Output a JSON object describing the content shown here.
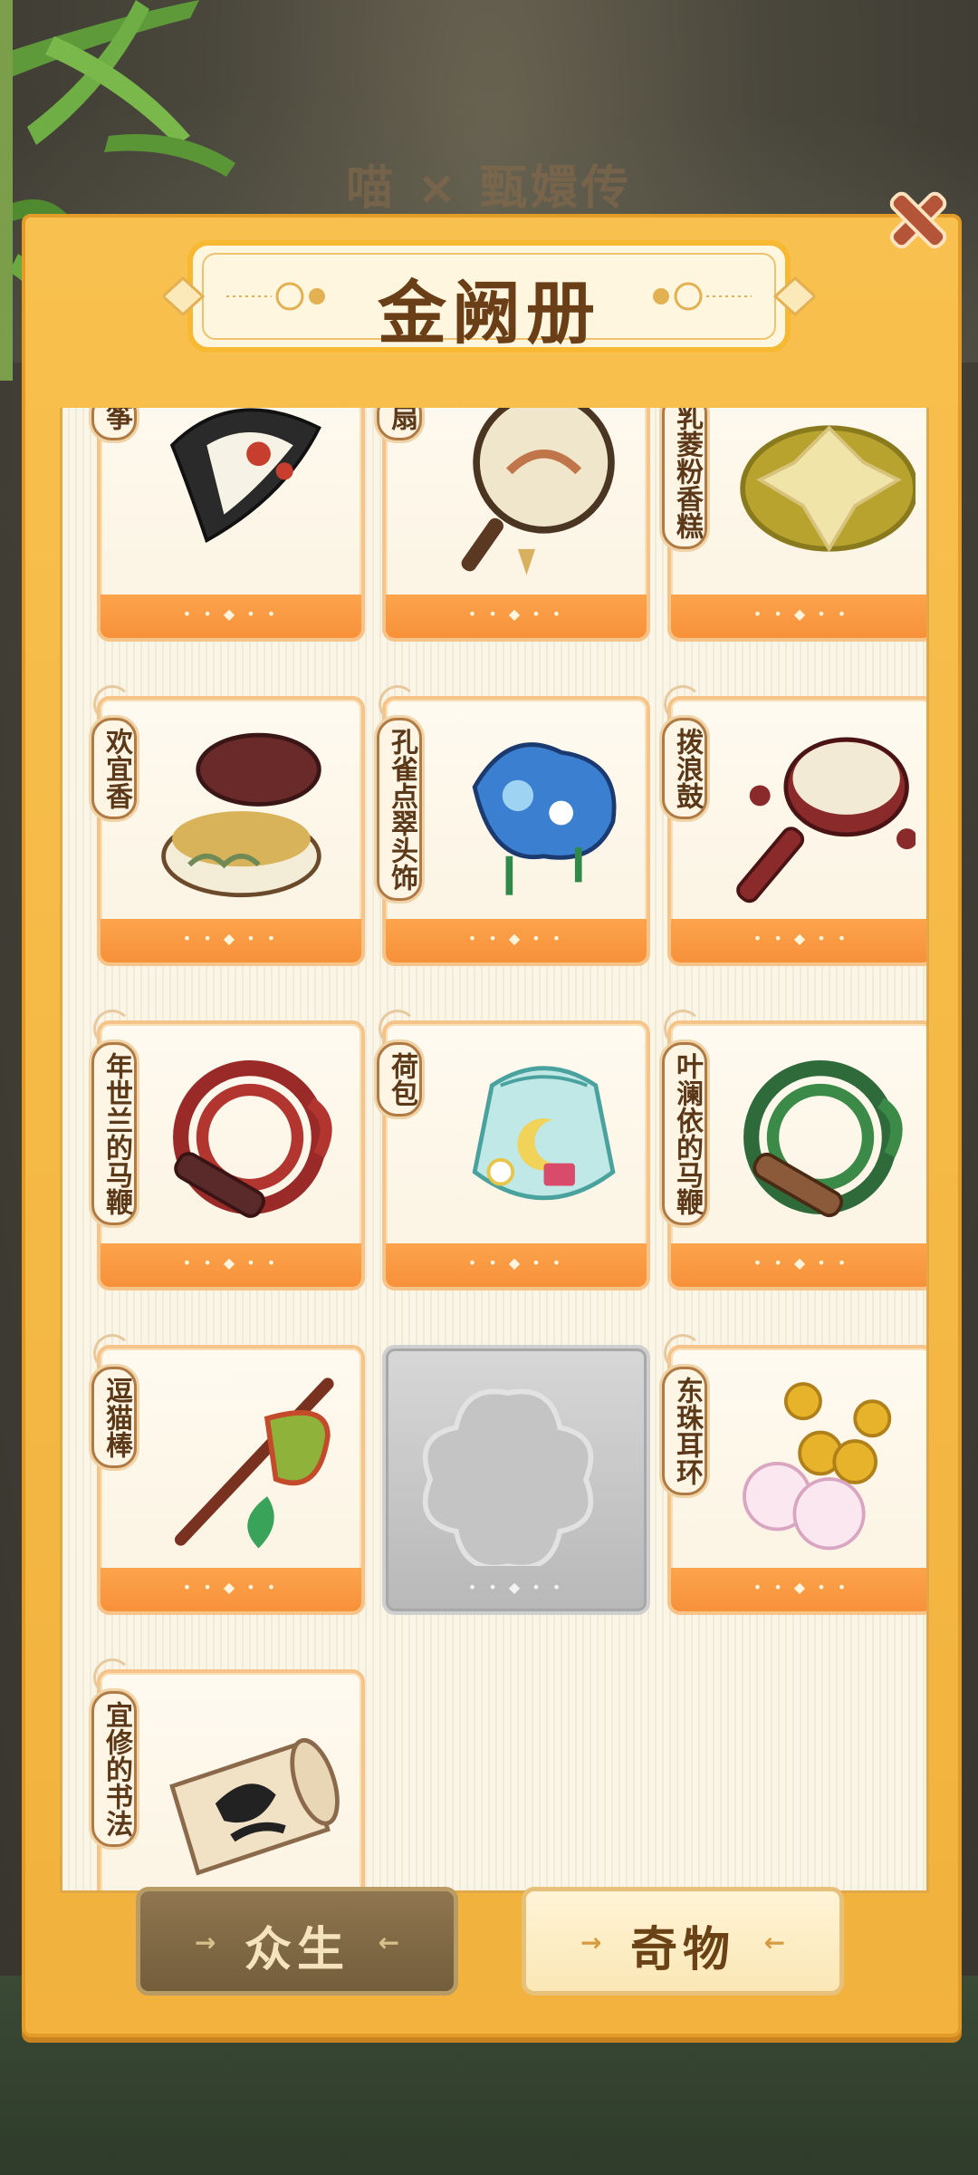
{
  "app": {
    "title": "金阙册",
    "logo_text": "喵 × 甄嬛传"
  },
  "tabs": [
    {
      "label": "众生",
      "active": false
    },
    {
      "label": "奇物",
      "active": true
    }
  ],
  "items": [
    {
      "name": "筝",
      "icon": "kite-icon"
    },
    {
      "name": "扇",
      "icon": "round-fan-icon"
    },
    {
      "name": "乳菱粉香糕",
      "icon": "cake-plate-icon"
    },
    {
      "name": "欢宜香",
      "icon": "incense-box-icon"
    },
    {
      "name": "孔雀点翠头饰",
      "icon": "headdress-icon"
    },
    {
      "name": "拨浪鼓",
      "icon": "rattle-drum-icon"
    },
    {
      "name": "年世兰的马鞭",
      "icon": "red-whip-icon"
    },
    {
      "name": "荷包",
      "icon": "pouch-icon"
    },
    {
      "name": "叶澜依的马鞭",
      "icon": "green-whip-icon"
    },
    {
      "name": "逗猫棒",
      "icon": "cat-teaser-icon"
    },
    {
      "name": "",
      "icon": "locked-card-icon",
      "locked": true
    },
    {
      "name": "东珠耳环",
      "icon": "pearl-earring-icon"
    },
    {
      "name": "宜修的书法",
      "icon": "calligraphy-scroll-icon"
    }
  ],
  "colors": {
    "accent": "#f7913a",
    "panel": "#f5b640",
    "locked": "#b8b8b8"
  }
}
